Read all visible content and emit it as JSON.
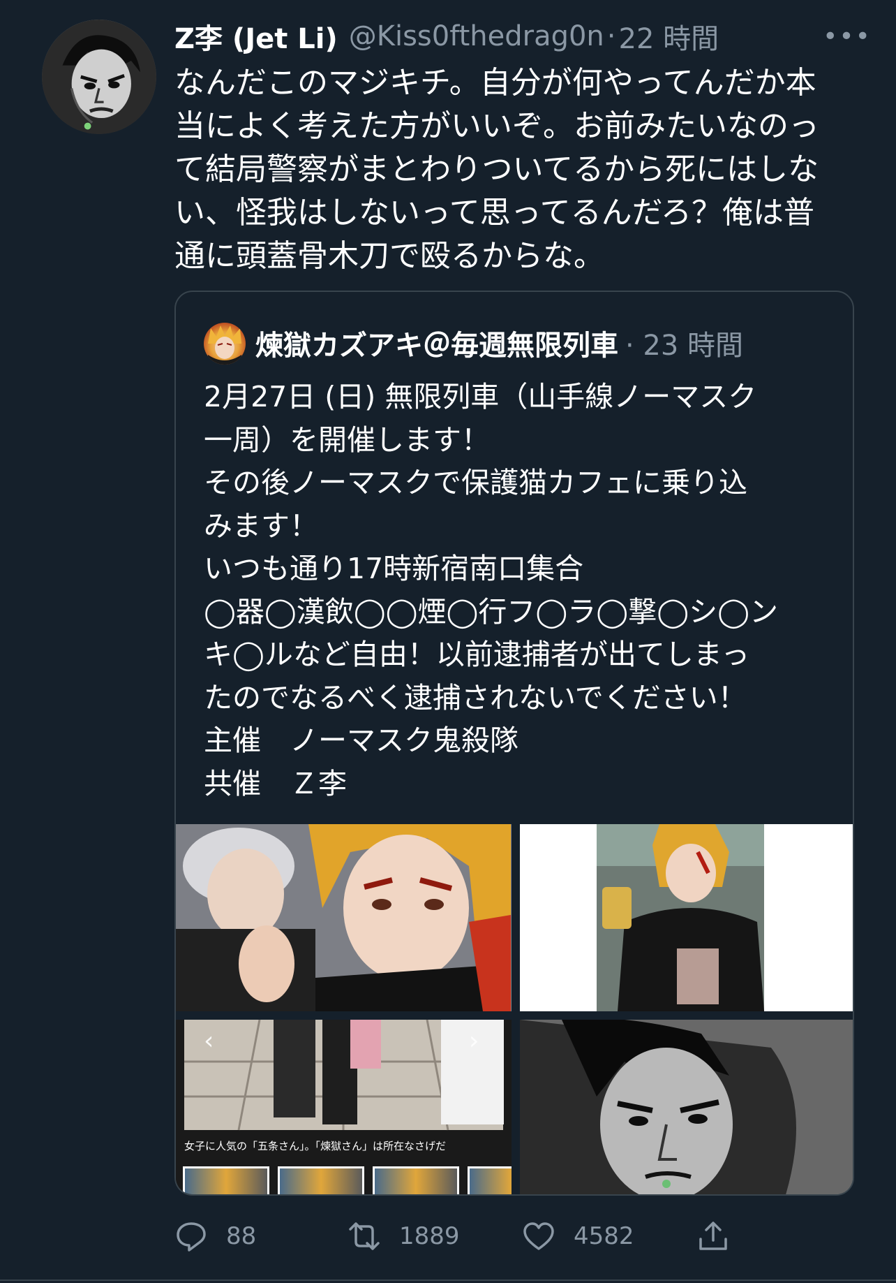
{
  "tweet": {
    "display_name": "Z李 (Jet Li)",
    "handle": "@Kiss0fthedrag0n",
    "separator": "·",
    "time": "22 時間",
    "more_label": "•••",
    "text": "なんだこのマジキチ。自分が何やってんだか本\n当によく考えた方がいいぞ。お前みたいなのっ\nて結局警察がまとわりついてるから死にはしな\nい、怪我はしないって思ってるんだろ？俺は普\n通に頭蓋骨木刀で殴るからな。"
  },
  "quote": {
    "display_name": "煉獄カズアキ＠毎週無限列車",
    "time": "· 23 時間",
    "text": "2月27日 (日) 無限列車（山手線ノーマスク\n一周）を開催します！\nその後ノーマスクで保護猫カフェに乗り込\nみます！\nいつも通り17時新宿南口集合\n◯器◯漢飲◯◯煙◯行フ◯ラ◯撃◯シ◯ン\nキ◯ルなど自由！以前逮捕者が出てしまっ\nたのでなるべく逮捕されないでください！\n主催　ノーマスク鬼殺隊\n共催　Ｚ李",
    "media_caption": "女子に人気の「五条さん」。「煉獄さん」は所在なさげだ"
  },
  "actions": {
    "reply_count": "88",
    "retweet_count": "1889",
    "like_count": "4582"
  },
  "icons": {
    "reply": "reply-icon",
    "retweet": "retweet-icon",
    "like": "heart-icon",
    "share": "share-icon"
  },
  "colors": {
    "background": "#15202b",
    "secondary_text": "#8b98a5",
    "border": "#38444d"
  }
}
